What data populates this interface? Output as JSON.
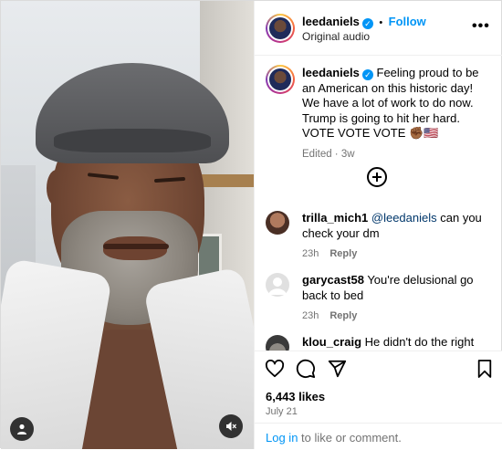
{
  "post": {
    "username": "leedaniels",
    "follow_label": "Follow",
    "dot_separator": "•",
    "audio": "Original audio",
    "more_label": "•••"
  },
  "caption": {
    "username": "leedaniels",
    "text": "Feeling proud to be an American on this historic day! We have a lot of work to do now. Trump is going to hit her hard. VOTE VOTE VOTE ✊🏾🇺🇸",
    "edited": "Edited",
    "dot": " · ",
    "age": "3w"
  },
  "comments": [
    {
      "username": "trilla_mich1",
      "mention": "@leedaniels",
      "text": " can you check your dm",
      "age": "23h",
      "reply": "Reply"
    },
    {
      "username": "garycast58",
      "mention": "",
      "text": " You're delusional go back to bed",
      "age": "23h",
      "reply": "Reply"
    },
    {
      "username": "klou_craig",
      "mention": "",
      "text": " He didn't do the right",
      "age": "",
      "reply": ""
    }
  ],
  "stats": {
    "likes": "6,443 likes",
    "date": "July 21"
  },
  "footer": {
    "login_link": "Log in",
    "login_rest": " to like or comment."
  },
  "colors": {
    "accent": "#0095f6",
    "verified": "#0095f6",
    "muted": "#737373"
  },
  "icons": [
    "verified-badge-icon",
    "more-options-icon",
    "load-more-plus-icon",
    "heart-icon",
    "comment-icon",
    "share-icon",
    "bookmark-icon",
    "user-tag-icon",
    "mute-icon"
  ]
}
